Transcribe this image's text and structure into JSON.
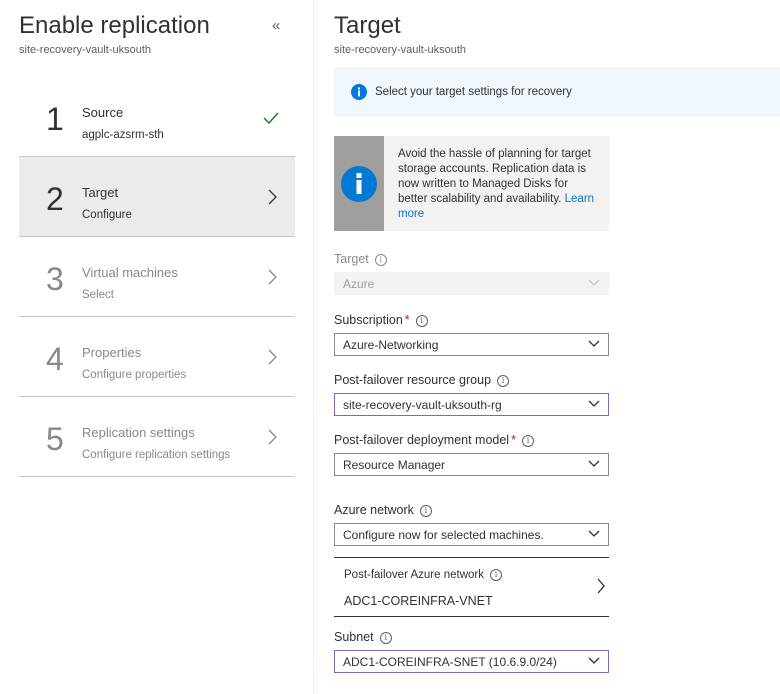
{
  "left": {
    "title": "Enable replication",
    "subtitle": "site-recovery-vault-uksouth",
    "collapse_glyph": "«",
    "steps": [
      {
        "num": "1",
        "label": "Source",
        "sub": "agplc-azsrm-sth",
        "state": "done"
      },
      {
        "num": "2",
        "label": "Target",
        "sub": "Configure",
        "state": "active"
      },
      {
        "num": "3",
        "label": "Virtual machines",
        "sub": "Select",
        "state": "disabled"
      },
      {
        "num": "4",
        "label": "Properties",
        "sub": "Configure properties",
        "state": "disabled"
      },
      {
        "num": "5",
        "label": "Replication settings",
        "sub": "Configure replication settings",
        "state": "disabled"
      }
    ]
  },
  "right": {
    "title": "Target",
    "subtitle": "site-recovery-vault-uksouth",
    "banner_text": "Select your target settings for recovery",
    "info_box": {
      "text": "Avoid the hassle of planning for target storage accounts. Replication data is now written to Managed Disks for better scalability and availability.",
      "link": "Learn more"
    },
    "fields": {
      "target": {
        "label": "Target",
        "value": "Azure"
      },
      "subscription": {
        "label": "Subscription",
        "value": "Azure-Networking"
      },
      "resource_group": {
        "label": "Post-failover resource group",
        "value": "site-recovery-vault-uksouth-rg"
      },
      "deployment_model": {
        "label": "Post-failover deployment model",
        "value": "Resource Manager"
      },
      "azure_network": {
        "label": "Azure network",
        "value": "Configure now for selected machines."
      },
      "post_failover_network": {
        "label": "Post-failover Azure network",
        "value": "ADC1-COREINFRA-VNET"
      },
      "subnet": {
        "label": "Subnet",
        "value": "ADC1-COREINFRA-SNET (10.6.9.0/24)"
      }
    },
    "required_marker": "*",
    "info_glyph": "i"
  },
  "colors": {
    "accent": "#0078d4",
    "success": "#107c10",
    "focus_border": "#8764b8",
    "required": "#a4262c"
  }
}
